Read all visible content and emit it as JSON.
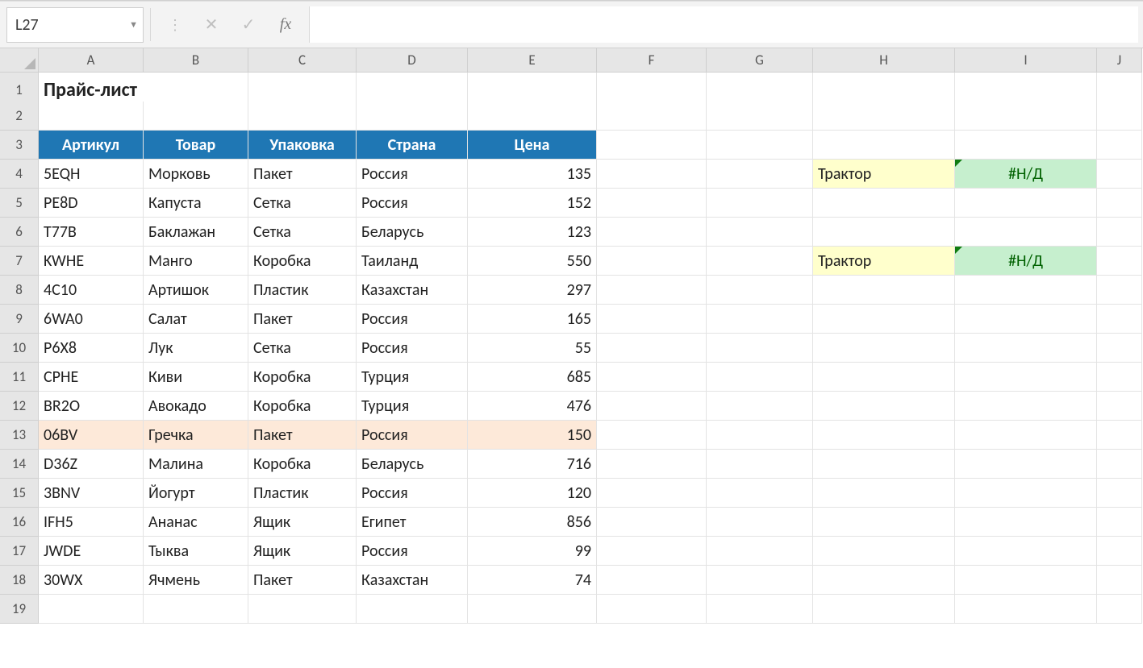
{
  "formula_bar": {
    "name_box": "L27",
    "formula": "",
    "fx_label": "fx"
  },
  "columns": [
    "A",
    "B",
    "C",
    "D",
    "E",
    "F",
    "G",
    "H",
    "I",
    "J"
  ],
  "row_headers": [
    "1",
    "2",
    "3",
    "4",
    "5",
    "6",
    "7",
    "8",
    "9",
    "10",
    "11",
    "12",
    "13",
    "14",
    "15",
    "16",
    "17",
    "18",
    "19"
  ],
  "title": "Прайс-лист",
  "table_header": {
    "col_a": "Артикул",
    "col_b": "Товар",
    "col_c": "Упаковка",
    "col_d": "Страна",
    "col_e": "Цена"
  },
  "rows": [
    {
      "a": "5EQH",
      "b": "Морковь",
      "c": "Пакет",
      "d": "Россия",
      "e": "135"
    },
    {
      "a": "PE8D",
      "b": "Капуста",
      "c": "Сетка",
      "d": "Россия",
      "e": "152"
    },
    {
      "a": "T77B",
      "b": "Баклажан",
      "c": "Сетка",
      "d": "Беларусь",
      "e": "123"
    },
    {
      "a": "KWHE",
      "b": "Манго",
      "c": "Коробка",
      "d": "Таиланд",
      "e": "550"
    },
    {
      "a": "4C10",
      "b": "Артишок",
      "c": "Пластик",
      "d": "Казахстан",
      "e": "297"
    },
    {
      "a": "6WA0",
      "b": "Салат",
      "c": "Пакет",
      "d": "Россия",
      "e": "165"
    },
    {
      "a": "P6X8",
      "b": "Лук",
      "c": "Сетка",
      "d": "Россия",
      "e": "55"
    },
    {
      "a": "CPHE",
      "b": "Киви",
      "c": "Коробка",
      "d": "Турция",
      "e": "685"
    },
    {
      "a": "BR2O",
      "b": "Авокадо",
      "c": "Коробка",
      "d": "Турция",
      "e": "476"
    },
    {
      "a": "06BV",
      "b": "Гречка",
      "c": "Пакет",
      "d": "Россия",
      "e": "150"
    },
    {
      "a": "D36Z",
      "b": "Малина",
      "c": "Коробка",
      "d": "Беларусь",
      "e": "716"
    },
    {
      "a": "3BNV",
      "b": "Йогурт",
      "c": "Пластик",
      "d": "Россия",
      "e": "120"
    },
    {
      "a": "IFH5",
      "b": "Ананас",
      "c": "Ящик",
      "d": "Египет",
      "e": "856"
    },
    {
      "a": "JWDE",
      "b": "Тыква",
      "c": "Ящик",
      "d": "Россия",
      "e": "99"
    },
    {
      "a": "30WX",
      "b": "Ячмень",
      "c": "Пакет",
      "d": "Казахстан",
      "e": "74"
    }
  ],
  "lookup": {
    "h4": "Трактор",
    "i4": "#Н/Д",
    "h7": "Трактор",
    "i7": "#Н/Д"
  }
}
